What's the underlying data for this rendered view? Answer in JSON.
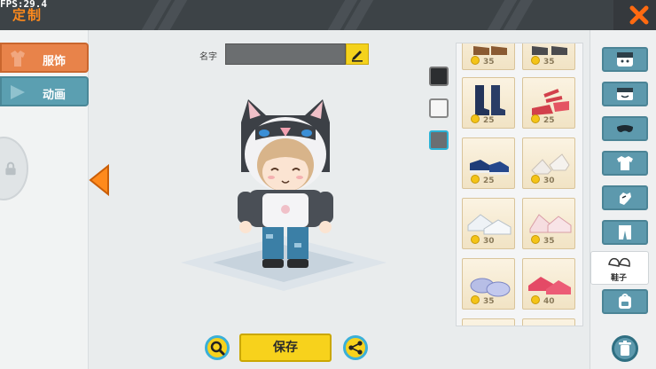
{
  "hud": {
    "fps": "FPS:29.4",
    "title": "定制"
  },
  "left_tabs": [
    {
      "label": "服饰",
      "active": true
    },
    {
      "label": "动画",
      "active": false
    }
  ],
  "editor": {
    "name_label": "名字",
    "name_value": "",
    "save_label": "保存"
  },
  "colors": [
    "#2c2e30",
    "#f5f5f5",
    "#6a6f72"
  ],
  "items": [
    {
      "price": "35",
      "icon": "brown-boots-icon"
    },
    {
      "price": "35",
      "icon": "dark-boots-icon"
    },
    {
      "price": "25",
      "icon": "navy-boots-icon"
    },
    {
      "price": "25",
      "icon": "red-strap-sandals-icon"
    },
    {
      "price": "25",
      "icon": "blue-sneakers-icon"
    },
    {
      "price": "30",
      "icon": "white-heels-icon"
    },
    {
      "price": "30",
      "icon": "white-sneakers-icon"
    },
    {
      "price": "35",
      "icon": "pink-shoes-icon"
    },
    {
      "price": "35",
      "icon": "lilac-slippers-icon"
    },
    {
      "price": "40",
      "icon": "pink-slippers-icon"
    }
  ],
  "categories": [
    {
      "icon": "face-icon"
    },
    {
      "icon": "hat-icon"
    },
    {
      "icon": "mask-icon"
    },
    {
      "icon": "shirt-icon"
    },
    {
      "icon": "glove-icon"
    },
    {
      "icon": "pants-icon"
    },
    {
      "icon": "shoes-icon",
      "label": "鞋子",
      "active": true
    },
    {
      "icon": "backpack-icon"
    }
  ]
}
